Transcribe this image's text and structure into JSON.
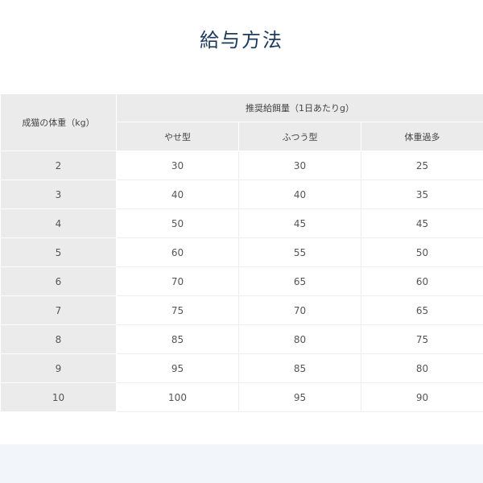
{
  "title": "給与方法",
  "table": {
    "row_header": "成猫の体重（kg）",
    "group_header": "推奨給餌量（1日あたりg）",
    "columns": [
      "やせ型",
      "ふつう型",
      "体重過多"
    ],
    "rows": [
      {
        "weight": "2",
        "values": [
          "30",
          "30",
          "25"
        ]
      },
      {
        "weight": "3",
        "values": [
          "40",
          "40",
          "35"
        ]
      },
      {
        "weight": "4",
        "values": [
          "50",
          "45",
          "45"
        ]
      },
      {
        "weight": "5",
        "values": [
          "60",
          "55",
          "50"
        ]
      },
      {
        "weight": "6",
        "values": [
          "70",
          "65",
          "60"
        ]
      },
      {
        "weight": "7",
        "values": [
          "75",
          "70",
          "65"
        ]
      },
      {
        "weight": "8",
        "values": [
          "85",
          "80",
          "75"
        ]
      },
      {
        "weight": "9",
        "values": [
          "95",
          "85",
          "80"
        ]
      },
      {
        "weight": "10",
        "values": [
          "100",
          "95",
          "90"
        ]
      }
    ]
  },
  "colors": {
    "title": "#1e3a5f",
    "header_bg": "#ebebeb",
    "footer_band": "#f2f5f9"
  }
}
